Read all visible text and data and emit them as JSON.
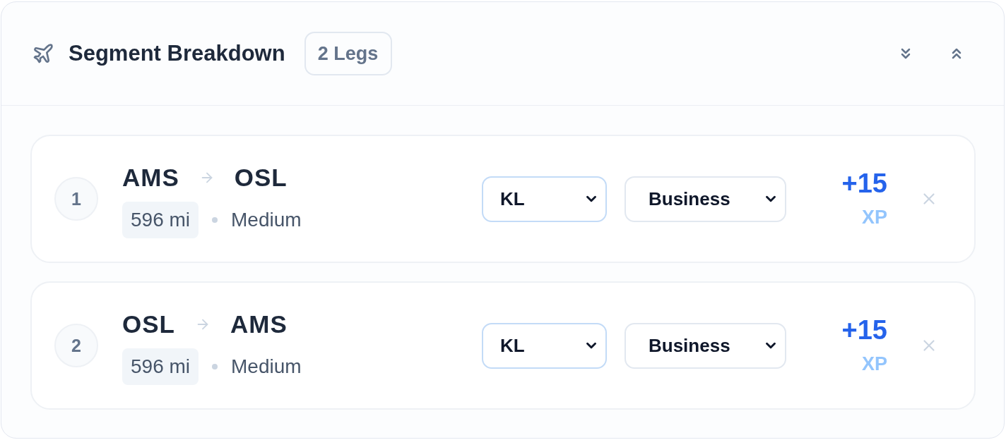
{
  "header": {
    "title": "Segment Breakdown",
    "badge": "2 Legs"
  },
  "segments": [
    {
      "number": "1",
      "origin": "AMS",
      "destination": "OSL",
      "distance": "596 mi",
      "haul": "Medium",
      "carrier": "KL",
      "cabin": "Business",
      "xp": "+15",
      "xp_unit": "XP"
    },
    {
      "number": "2",
      "origin": "OSL",
      "destination": "AMS",
      "distance": "596 mi",
      "haul": "Medium",
      "carrier": "KL",
      "cabin": "Business",
      "xp": "+15",
      "xp_unit": "XP"
    }
  ]
}
